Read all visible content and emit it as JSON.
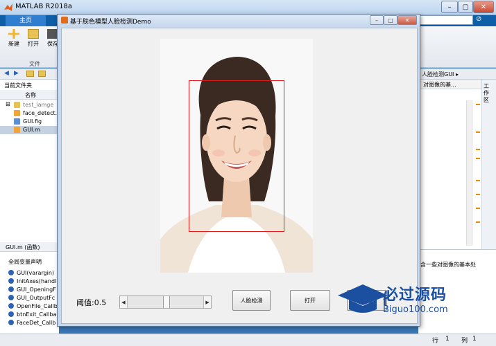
{
  "matlab": {
    "title": "MATLAB R2018a",
    "tab_home": "主页",
    "ribbon": {
      "new": "新建",
      "open": "打开",
      "save": "保存",
      "section": "文件"
    },
    "current_folder_title": "当前文件夹",
    "column_name": "名称",
    "files": [
      {
        "name": "test_iamge",
        "type": "folder"
      },
      {
        "name": "face_detect.m",
        "type": "m"
      },
      {
        "name": "GUI.fig",
        "type": "fig"
      },
      {
        "name": "GUI.m",
        "type": "m",
        "selected": true
      }
    ],
    "details_title": "GUI.m (函数)",
    "details_subtitle": "全局变量声明",
    "functions": [
      "GUI(varargin)",
      "InitAxes(handl",
      "GUI_OpeningF",
      "GUI_OutputFc",
      "OpenFile_Callb",
      "btnExit_Callba",
      "FaceDet_Callb"
    ],
    "editor_path": "人脸检测GUI ▸",
    "editor_tab": "对图像的基...",
    "workspace_label": "工作区",
    "command_text": "含一些对图像的基本处",
    "status": {
      "row_label": "行",
      "row_value": "1",
      "col_label": "列",
      "col_value": "1"
    }
  },
  "figure": {
    "title": "基于肤色模型人脸检测Demo",
    "threshold_label": "阈值:0.5",
    "threshold_value": 0.5,
    "buttons": {
      "detect": "人脸检测",
      "open": "打开",
      "exit": "退出"
    }
  },
  "watermark": {
    "text": "必过源码",
    "sub": "Biguo100.com"
  },
  "colors": {
    "accent": "#0e5ea8",
    "face_box": "#e01818",
    "watermark": "#1b4fa0"
  }
}
